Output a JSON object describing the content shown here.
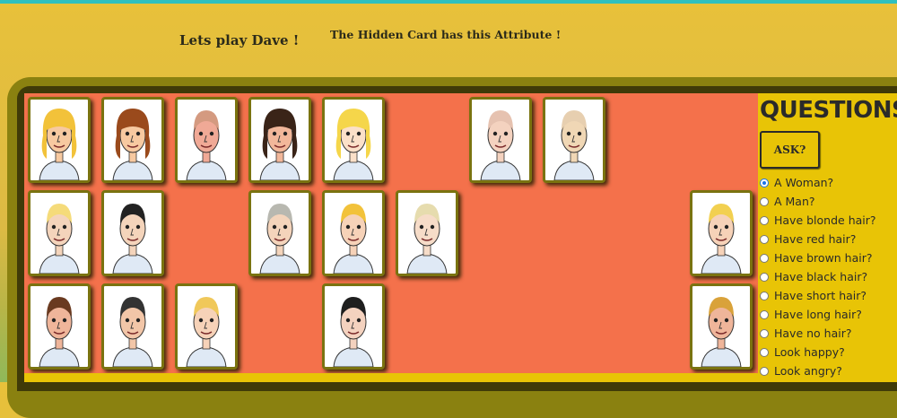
{
  "header": {
    "title": "Lets play Dave !",
    "hidden_attribute": "The Hidden Card has this Attribute !"
  },
  "colors": {
    "board": "#f4714b",
    "panel": "#e8c406",
    "frame": "#8a8110",
    "topbar": "#2fc0bf"
  },
  "cards": [
    {
      "name": "blonde-woman-angry",
      "row": 1,
      "col": 1,
      "hair": "#f2c23a",
      "skin": "#f7c9a0",
      "woman": true
    },
    {
      "name": "brown-hair-woman-glasses",
      "row": 1,
      "col": 2,
      "hair": "#9a4a1c",
      "skin": "#f7c9a0",
      "woman": true
    },
    {
      "name": "bald-man-angry",
      "row": 1,
      "col": 3,
      "hair": "#d49a80",
      "skin": "#f0a996",
      "woman": false
    },
    {
      "name": "black-hair-woman",
      "row": 1,
      "col": 4,
      "hair": "#3a2418",
      "skin": "#f2b79a",
      "woman": true
    },
    {
      "name": "blonde-woman-laughing",
      "row": 1,
      "col": 5,
      "hair": "#f5d64a",
      "skin": "#fbe0c8",
      "woman": true
    },
    {
      "name": "bald-old-man",
      "row": 1,
      "col": 7,
      "hair": "#e6c2b0",
      "skin": "#f4d2bf",
      "woman": false
    },
    {
      "name": "bald-fat-man",
      "row": 1,
      "col": 8,
      "hair": "#e7cfb0",
      "skin": "#f0d7b5",
      "woman": false
    },
    {
      "name": "blonde-man-stubble",
      "row": 2,
      "col": 1,
      "hair": "#f5db7a",
      "skin": "#f4d4bb",
      "woman": false
    },
    {
      "name": "black-hair-man-sunglasses",
      "row": 2,
      "col": 2,
      "hair": "#222222",
      "skin": "#f4d4bb",
      "woman": false
    },
    {
      "name": "grey-hair-man-glasses",
      "row": 2,
      "col": 4,
      "hair": "#b8b8b0",
      "skin": "#f4d4bb",
      "woman": false
    },
    {
      "name": "blonde-man-smiling",
      "row": 2,
      "col": 5,
      "hair": "#f2c23a",
      "skin": "#f6d2b8",
      "woman": false
    },
    {
      "name": "blonde-man-glasses",
      "row": 2,
      "col": 6,
      "hair": "#e6dcae",
      "skin": "#f6dcc8",
      "woman": false
    },
    {
      "name": "blonde-man-laughing",
      "row": 2,
      "col": 10,
      "hair": "#f2d050",
      "skin": "#f6d2b8",
      "woman": false
    },
    {
      "name": "brown-hair-man-grin",
      "row": 3,
      "col": 1,
      "hair": "#6a3a20",
      "skin": "#efb59a",
      "woman": false
    },
    {
      "name": "black-hair-man-blue-shirt",
      "row": 3,
      "col": 2,
      "hair": "#333333",
      "skin": "#f2c6a8",
      "woman": false
    },
    {
      "name": "blonde-man-worried",
      "row": 3,
      "col": 3,
      "hair": "#f0c85a",
      "skin": "#f6d2b8",
      "woman": false
    },
    {
      "name": "black-hair-man-smirk",
      "row": 3,
      "col": 5,
      "hair": "#1e1e1e",
      "skin": "#f4d2bf",
      "woman": false
    },
    {
      "name": "blonde-man-angry",
      "row": 3,
      "col": 10,
      "hair": "#d9a23a",
      "skin": "#efb59a",
      "woman": false
    }
  ],
  "questions_panel": {
    "title": "QUESTIONS",
    "ask_label": "ASK?",
    "selected": "A Woman?",
    "options": [
      "A Woman?",
      "A Man?",
      "Have blonde hair?",
      "Have red hair?",
      "Have brown hair?",
      "Have black hair?",
      "Have short hair?",
      "Have long hair?",
      "Have no hair?",
      "Look happy?",
      "Look angry?"
    ]
  }
}
